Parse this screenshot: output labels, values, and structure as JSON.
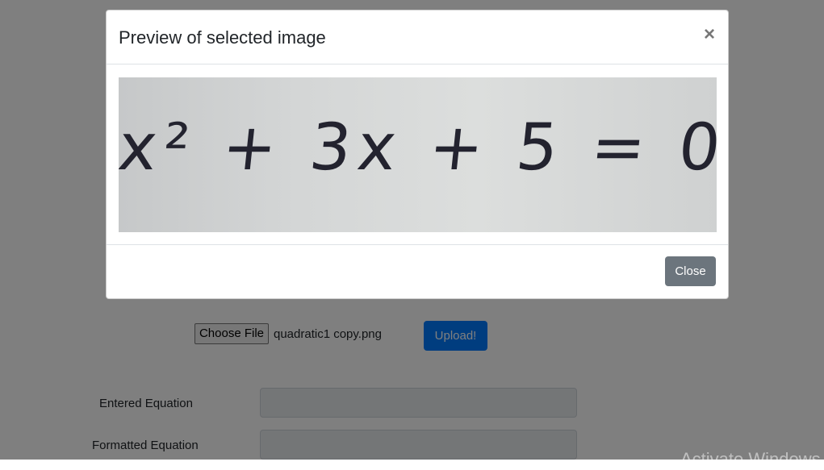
{
  "page": {
    "choose_file_label": "Choose File",
    "file_name": "quadratic1 copy.png",
    "upload_label": "Upload!",
    "entered_equation_label": "Entered Equation",
    "formatted_equation_label": "Formatted Equation",
    "watermark": "Activate Windows"
  },
  "modal": {
    "title": "Preview of selected image",
    "close_icon": "×",
    "close_label": "Close",
    "image_handwriting": "x² + 3x + 5 = 0"
  },
  "colors": {
    "primary": "#007bff",
    "secondary": "#6c757d"
  }
}
